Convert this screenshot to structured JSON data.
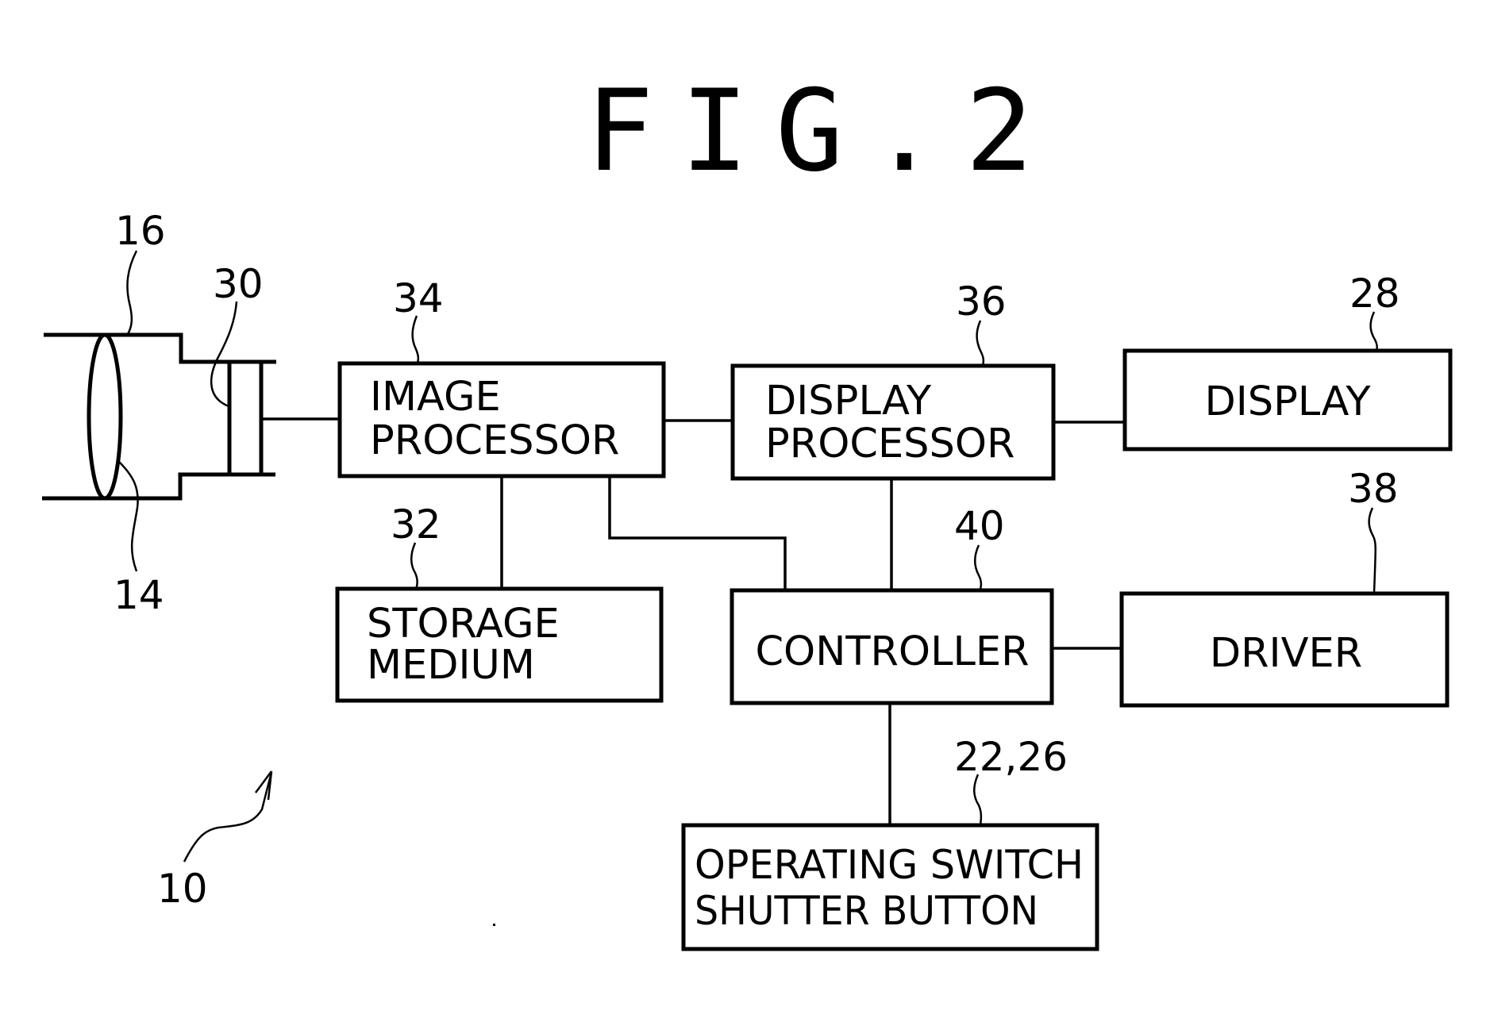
{
  "figure": {
    "title": "FIG.2",
    "system_ref": "10"
  },
  "optics": {
    "lens_ref": "14",
    "barrel_ref": "16",
    "sensor_ref": "30"
  },
  "blocks": {
    "image_processor": {
      "ref": "34",
      "line1": "IMAGE",
      "line2": "PROCESSOR"
    },
    "display_processor": {
      "ref": "36",
      "line1": "DISPLAY",
      "line2": "PROCESSOR"
    },
    "display": {
      "ref": "28",
      "label": "DISPLAY"
    },
    "storage_medium": {
      "ref": "32",
      "line1": "STORAGE",
      "line2": "MEDIUM"
    },
    "controller": {
      "ref": "40",
      "label": "CONTROLLER"
    },
    "driver": {
      "ref": "38",
      "label": "DRIVER"
    },
    "operating_switch": {
      "ref": "22,26",
      "line1": "OPERATING SWITCH",
      "line2": "SHUTTER BUTTON"
    }
  }
}
